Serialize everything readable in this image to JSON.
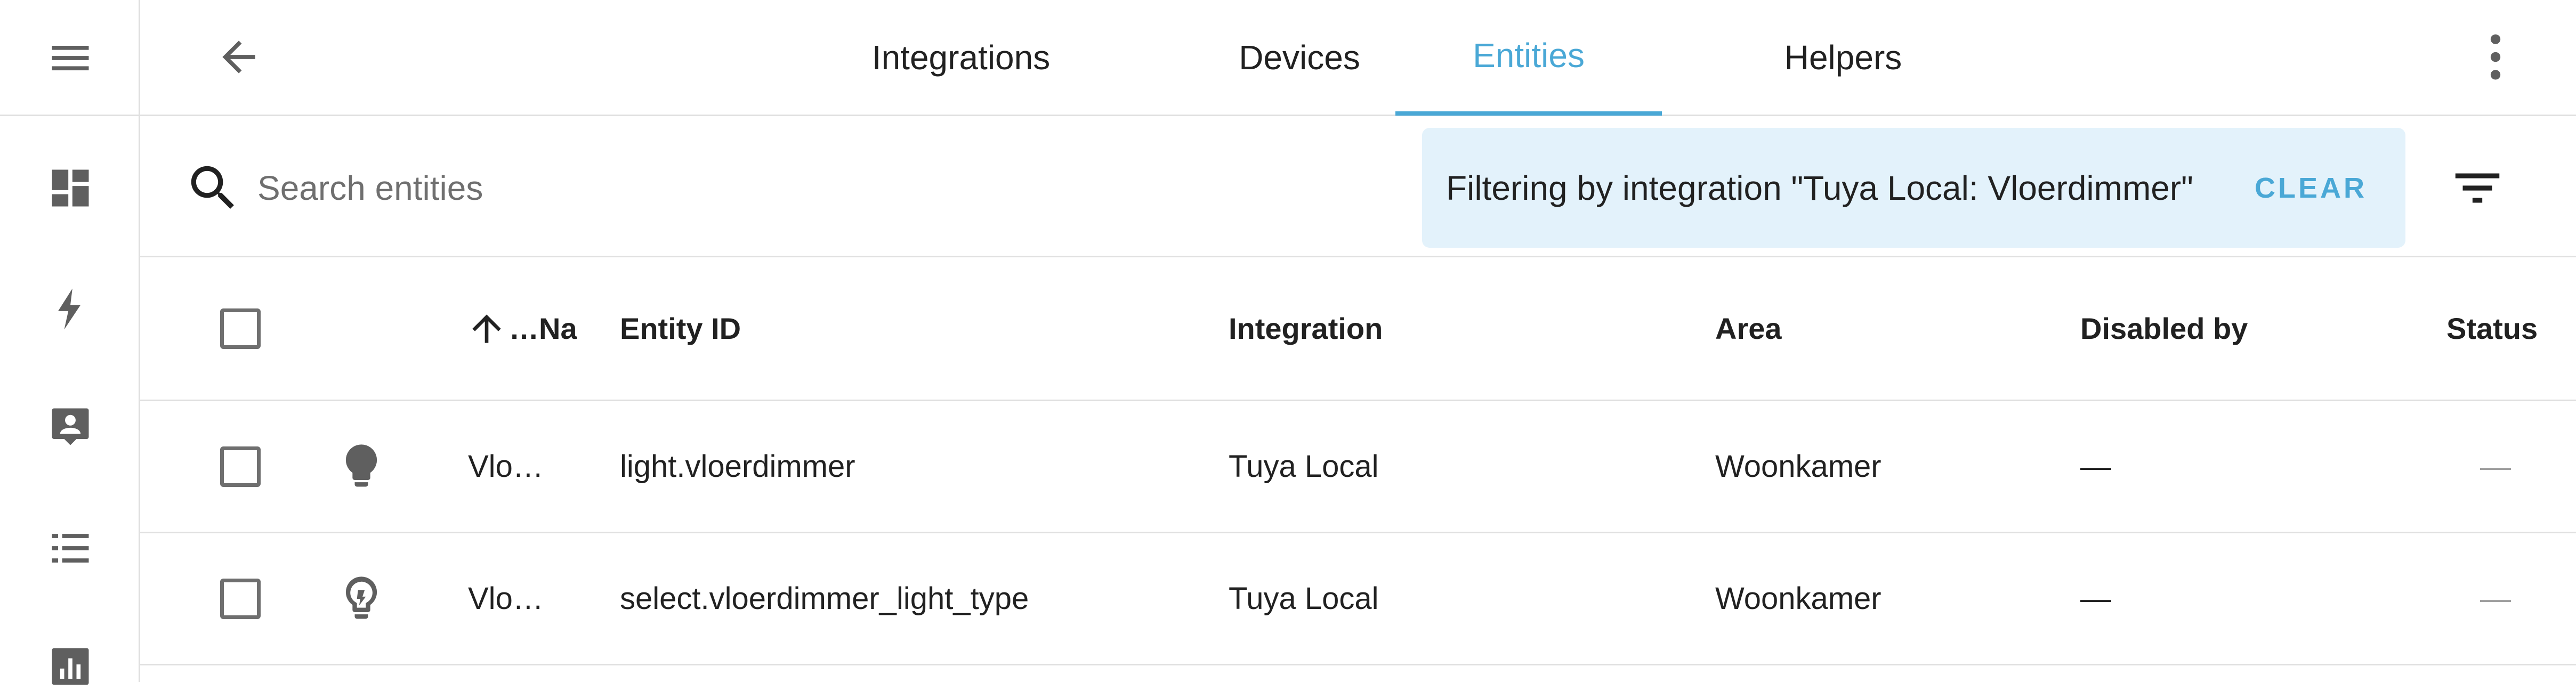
{
  "nav": {
    "tabs": [
      {
        "label": "Integrations",
        "active": false
      },
      {
        "label": "Devices",
        "active": false
      },
      {
        "label": "Entities",
        "active": true
      },
      {
        "label": "Helpers",
        "active": false
      }
    ],
    "back_icon": "arrow-left-icon",
    "overflow_icon": "dots-vertical-icon"
  },
  "sidebar": {
    "items": [
      {
        "icon": "menu-icon"
      },
      {
        "icon": "dashboard-icon"
      },
      {
        "icon": "energy-icon"
      },
      {
        "icon": "account-box-icon"
      },
      {
        "icon": "logbook-icon"
      },
      {
        "icon": "history-icon"
      }
    ]
  },
  "toolbar": {
    "search_placeholder": "Search entities",
    "filter_text": "Filtering by integration \"Tuya Local: Vloerdimmer\"",
    "clear_label": "CLEAR"
  },
  "table": {
    "columns": {
      "name": "…Na",
      "entity_id": "Entity ID",
      "integration": "Integration",
      "area": "Area",
      "disabled_by": "Disabled by",
      "status": "Status"
    },
    "sort": {
      "column": "name",
      "direction": "ascending"
    },
    "rows": [
      {
        "icon": "lightbulb-icon",
        "name": "Vlo…",
        "entity_id": "light.vloerdimmer",
        "integration": "Tuya Local",
        "area": "Woonkamer",
        "disabled_by": "—",
        "status": "—"
      },
      {
        "icon": "lightbulb-outline-icon",
        "name": "Vlo…",
        "entity_id": "select.vloerdimmer_light_type",
        "integration": "Tuya Local",
        "area": "Woonkamer",
        "disabled_by": "—",
        "status": "—"
      }
    ]
  },
  "colors": {
    "accent": "#4aa8d6",
    "filter_chip_bg": "#e3f2fb",
    "icon": "#5f5f5f",
    "divider": "#e0e0e0"
  }
}
